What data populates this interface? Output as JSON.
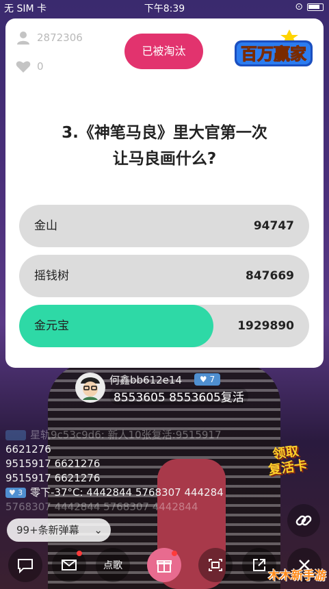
{
  "status_bar": {
    "carrier": "无 SIM 卡",
    "time": "下午8:39"
  },
  "card": {
    "viewers": "2872306",
    "likes": "0",
    "eliminated_label": "已被淘汰",
    "logo_text": "百万赢家",
    "question_line1": "3.《神笔马良》里大官第一次",
    "question_line2": "让马良画什么?",
    "options": [
      {
        "label": "金山",
        "count": "94747",
        "fraction": 0,
        "color": "#dcdcdc"
      },
      {
        "label": "摇钱树",
        "count": "847669",
        "fraction": 0,
        "color": "#dcdcdc"
      },
      {
        "label": "金元宝",
        "count": "1929890",
        "fraction": 0.67,
        "color": "#2ed9a6"
      }
    ]
  },
  "live": {
    "user_name": "何鑫bb612e14",
    "user_level": "♥ 7",
    "user_message": "8553605  8553605复活",
    "comments": [
      {
        "text": "星轨9c53c9d6: 新人10张复活:9515917",
        "faded": true,
        "tag": ""
      },
      {
        "text": "6621276",
        "faded": false,
        "tag": ""
      },
      {
        "text": "9515917 6621276",
        "faded": false,
        "tag": ""
      },
      {
        "text": "9515917 6621276",
        "faded": false,
        "tag": ""
      },
      {
        "text": "零下-37°C: 4442844   5768307   444284",
        "faded": false,
        "tag": "♥ 3"
      },
      {
        "text": "5768307   4442844   5768307   4442844",
        "faded": true,
        "tag": ""
      }
    ],
    "claim_card_line1": "领取",
    "claim_card_line2": "复活卡",
    "new_bullets_label": "99+条新弹幕",
    "song_label": "点歌"
  },
  "watermark": "木木新手游",
  "colors": {
    "accent_pink": "#e2336e",
    "correct_green": "#2ed9a6",
    "option_gray": "#dcdcdc"
  }
}
